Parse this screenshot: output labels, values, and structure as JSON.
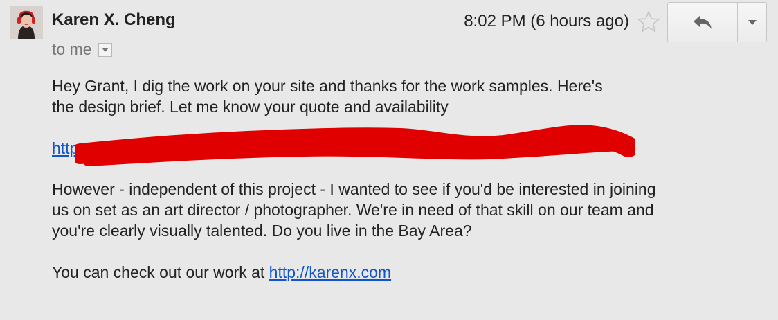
{
  "sender": {
    "name": "Karen X. Cheng",
    "recipient_label": "to me"
  },
  "message_meta": {
    "timestamp": "8:02 PM (6 hours ago)"
  },
  "actions": {
    "reply_icon": "reply-arrow-icon",
    "more_icon": "dropdown-caret-icon",
    "star_icon": "star-outline-icon"
  },
  "body": {
    "paragraph_1_line_1": "Hey Grant, I dig the work on your site and thanks for the work samples. Here's",
    "paragraph_1_line_2": "the design brief. Let me know your quote and availability",
    "redacted_link_visible": "https",
    "paragraph_2_line_1": "However - independent of this project - I wanted to see if you'd be interested in joining",
    "paragraph_2_line_2": "us on set as an art director / photographer. We're in need of that skill on our team and",
    "paragraph_2_line_3": "you're clearly visually talented. Do you live in the Bay Area?",
    "paragraph_3_text": "You can check out our work at ",
    "paragraph_3_link": "http://karenx.com"
  },
  "colors": {
    "background": "#e8e8e8",
    "link": "#1155cc",
    "redaction": "#e00000",
    "secondary_text": "#777777"
  }
}
